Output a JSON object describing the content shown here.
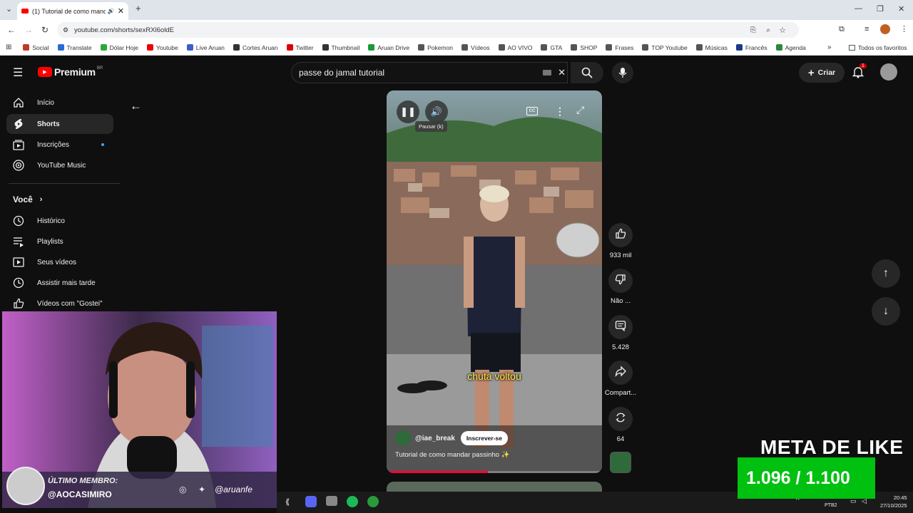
{
  "browser": {
    "tab_title": "(1) Tutorial de como mand",
    "url": "youtube.com/shorts/sexRXl6oldE",
    "bookmarks": [
      "Social",
      "Translate",
      "Dólar Hoje",
      "Youtube",
      "Live Aruan",
      "Cortes Aruan",
      "Twitter",
      "Thumbnail",
      "Aruan Drive",
      "Pokemon",
      "Vídeos",
      "AO VIVO",
      "GTA",
      "SHOP",
      "Frases",
      "TOP Youtube",
      "Músicas",
      "Francês",
      "Agenda"
    ],
    "all_bookmarks": "Todos os favoritos"
  },
  "header": {
    "logo": "Premium",
    "region": "BR",
    "search_value": "passe do jamal tutorial",
    "create_label": "Criar",
    "notif_count": "1"
  },
  "sidebar": {
    "items": [
      {
        "label": "Início",
        "icon": "home-icon"
      },
      {
        "label": "Shorts",
        "icon": "shorts-icon"
      },
      {
        "label": "Inscrições",
        "icon": "subscriptions-icon"
      },
      {
        "label": "YouTube Music",
        "icon": "music-icon"
      }
    ],
    "you_label": "Você",
    "you_items": [
      {
        "label": "Histórico",
        "icon": "history-icon"
      },
      {
        "label": "Playlists",
        "icon": "playlists-icon"
      },
      {
        "label": "Seus vídeos",
        "icon": "your-videos-icon"
      },
      {
        "label": "Assistir mais tarde",
        "icon": "watch-later-icon"
      },
      {
        "label": "Vídeos com \"Gostei\"",
        "icon": "liked-icon"
      }
    ]
  },
  "video": {
    "tooltip": "Pausar (k)",
    "caption": "chuta voltou",
    "channel": "@iae_break",
    "subscribe": "Inscrever-se",
    "title": "Tutorial de como mandar passinho ✨",
    "progress": 0.47
  },
  "actions": {
    "likes": "933 mil",
    "dislike": "Não ...",
    "comments": "5.428",
    "share": "Compart...",
    "remix": "64"
  },
  "overlay": {
    "last_member_label": "ÚLTIMO MEMBRO:",
    "last_member": "@AOCASIMIRO",
    "handle": "@aruanfe",
    "meta_title": "META DE LIKE",
    "meta_value": "1.096 / 1.100"
  },
  "taskbar": {
    "lang": "POR",
    "layout": "PTB2",
    "time": "20:45",
    "date": "27/10/2025"
  }
}
